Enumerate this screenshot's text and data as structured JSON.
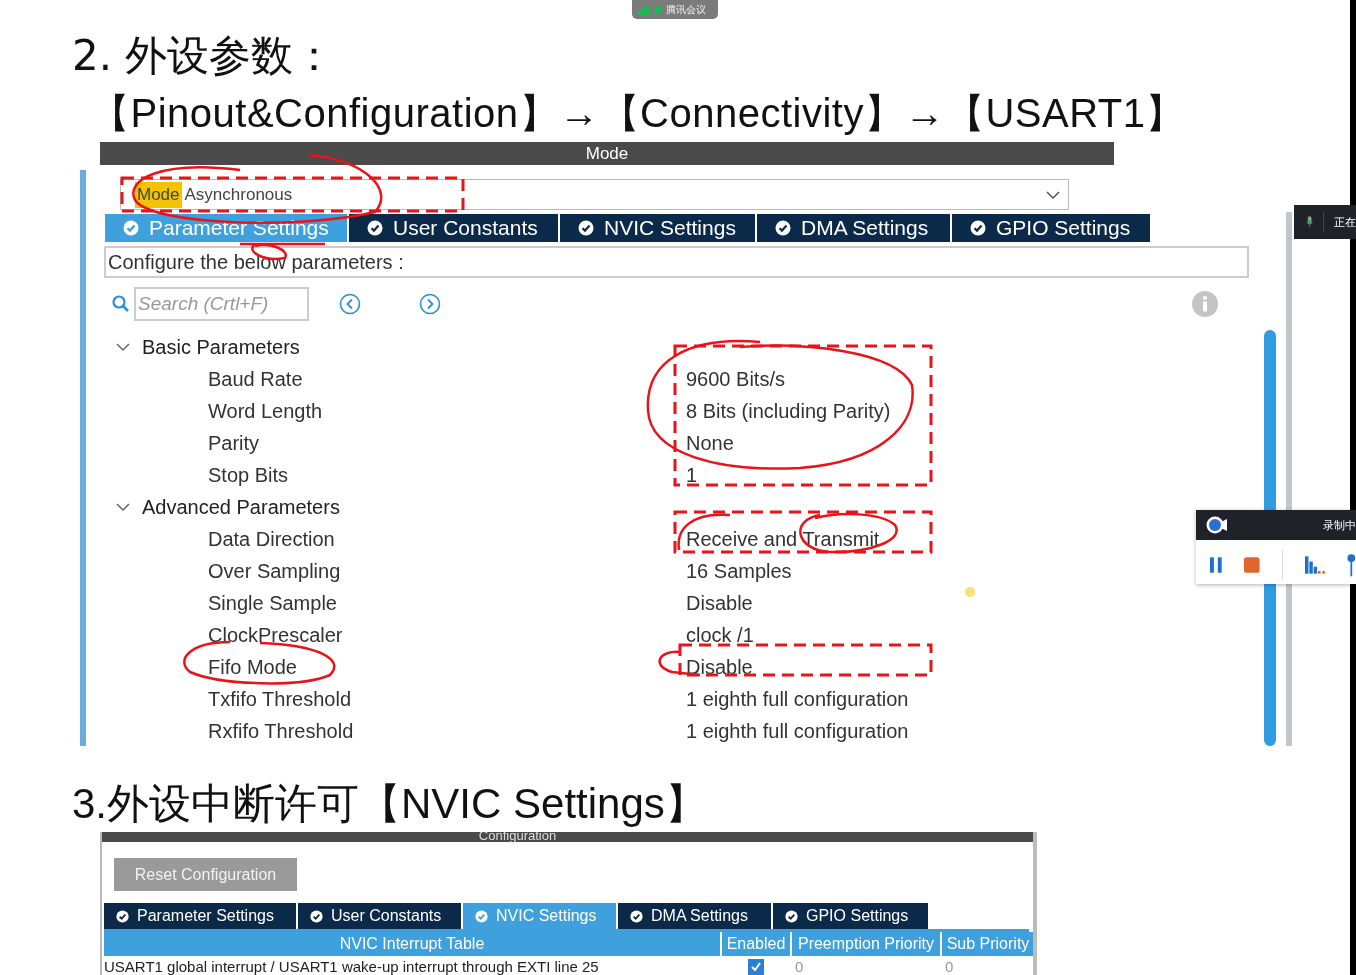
{
  "heading_1": {
    "title": "2. 外设参数：",
    "path": "【Pinout&Configuration】→【Connectivity】→【USART1】"
  },
  "panel_1": {
    "header": "Mode",
    "mode_field": {
      "label": "Mode",
      "value": "Asynchronous"
    },
    "tabs": [
      {
        "label": "Parameter Settings",
        "selected": true
      },
      {
        "label": "User Constants",
        "selected": false
      },
      {
        "label": "NVIC Settings",
        "selected": false
      },
      {
        "label": "DMA Settings",
        "selected": false
      },
      {
        "label": "GPIO Settings",
        "selected": false
      }
    ],
    "configure_label": "Configure the below parameters :",
    "search": {
      "placeholder": "Search (Crtl+F)"
    },
    "groups": [
      {
        "label": "Basic Parameters",
        "expanded": true,
        "children": [
          {
            "name": "Baud Rate",
            "value": "9600 Bits/s"
          },
          {
            "name": "Word Length",
            "value": "8 Bits (including Parity)"
          },
          {
            "name": "Parity",
            "value": "None"
          },
          {
            "name": "Stop Bits",
            "value": "1"
          }
        ]
      },
      {
        "label": "Advanced Parameters",
        "expanded": true,
        "children": [
          {
            "name": "Data Direction",
            "value": "Receive and Transmit"
          },
          {
            "name": "Over Sampling",
            "value": "16 Samples"
          },
          {
            "name": "Single Sample",
            "value": "Disable"
          },
          {
            "name": "ClockPrescaler",
            "value": "clock /1"
          },
          {
            "name": "Fifo Mode",
            "value": "Disable"
          },
          {
            "name": "Txfifo Threshold",
            "value": "1 eighth full configuration"
          },
          {
            "name": "Rxfifo Threshold",
            "value": "1 eighth full configuration"
          }
        ]
      }
    ]
  },
  "heading_2": {
    "title": "3.外设中断许可【NVIC Settings】"
  },
  "panel_2": {
    "header": "Configuration",
    "reset_button": "Reset Configuration",
    "tabs": [
      {
        "label": "Parameter Settings",
        "selected": false
      },
      {
        "label": "User Constants",
        "selected": false
      },
      {
        "label": "NVIC Settings",
        "selected": true
      },
      {
        "label": "DMA Settings",
        "selected": false
      },
      {
        "label": "GPIO Settings",
        "selected": false
      }
    ],
    "table": {
      "columns": [
        "NVIC Interrupt Table",
        "Enabled",
        "Preemption Priority",
        "Sub Priority"
      ],
      "rows": [
        {
          "name": "USART1 global interrupt / USART1 wake-up interrupt through EXTI line 25",
          "enabled": true,
          "preemption_priority": "0",
          "sub_priority": "0"
        }
      ]
    }
  },
  "meeting_overlay": {
    "app_label": "腾讯会议",
    "mic_status": "正在",
    "recording_status": "录制中"
  }
}
